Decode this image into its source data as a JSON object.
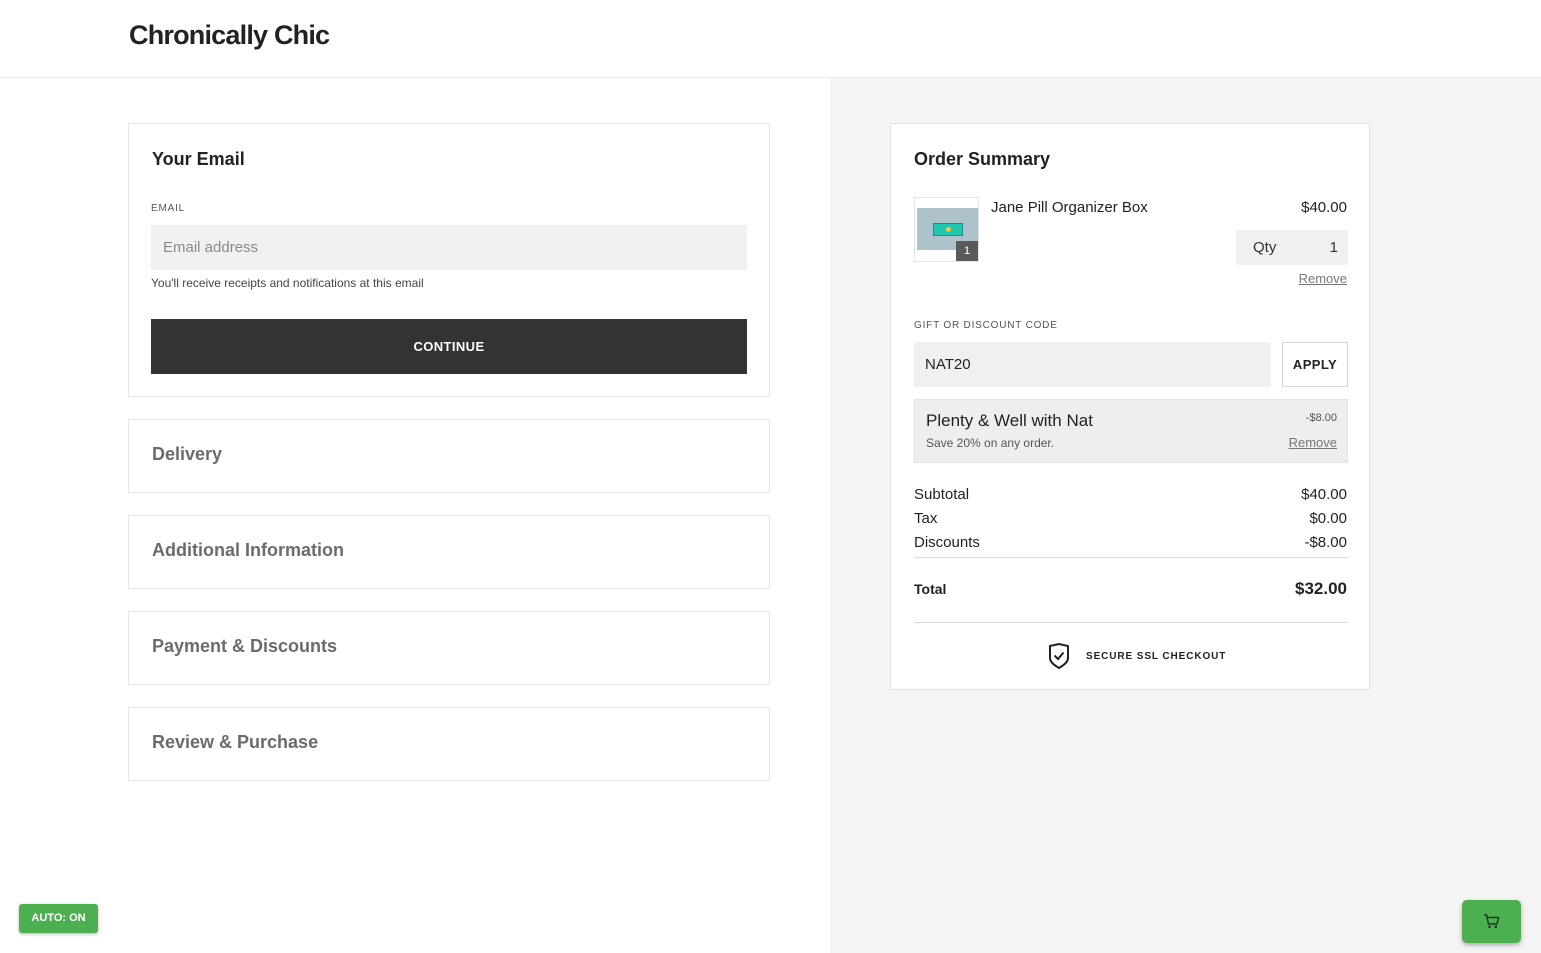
{
  "header": {
    "brand": "Chronically Chic"
  },
  "email_section": {
    "title": "Your Email",
    "field_label": "EMAIL",
    "placeholder": "Email address",
    "value": "",
    "hint": "You'll receive receipts and notifications at this email",
    "continue_label": "CONTINUE"
  },
  "steps": [
    {
      "title": "Delivery"
    },
    {
      "title": "Additional Information"
    },
    {
      "title": "Payment & Discounts"
    },
    {
      "title": "Review & Purchase"
    }
  ],
  "order_summary": {
    "title": "Order Summary",
    "item": {
      "name": "Jane Pill Organizer Box",
      "price": "$40.00",
      "qty_label": "Qty",
      "qty": "1",
      "badge": "1",
      "remove_label": "Remove"
    },
    "discount_label": "GIFT OR DISCOUNT CODE",
    "discount_code": "NAT20",
    "apply_label": "APPLY",
    "applied_discount": {
      "name": "Plenty & Well with Nat",
      "description": "Save 20% on any order.",
      "amount": "-$8.00",
      "remove_label": "Remove"
    },
    "subtotal_label": "Subtotal",
    "subtotal": "$40.00",
    "tax_label": "Tax",
    "tax": "$0.00",
    "discounts_label": "Discounts",
    "discounts": "-$8.00",
    "total_label": "Total",
    "total": "$32.00",
    "secure_label": "SECURE SSL CHECKOUT"
  },
  "auto_badge": "AUTO: ON",
  "icons": {
    "shield": "shield-check-icon",
    "cart": "cart-icon"
  },
  "colors": {
    "primary_button": "#333333",
    "accent_green": "#4caf50",
    "panel_bg": "#f4f4f4"
  }
}
